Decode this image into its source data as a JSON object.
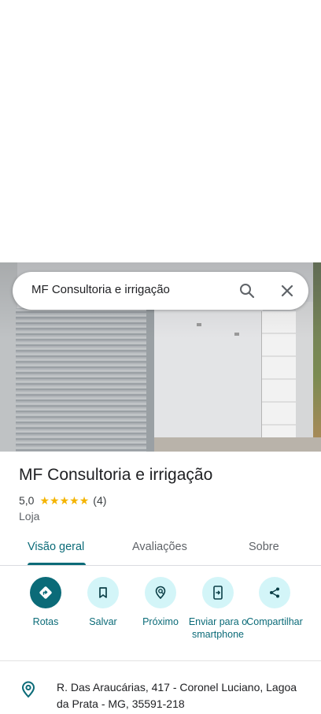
{
  "search": {
    "query": "MF Consultoria e irrigação"
  },
  "place": {
    "title": "MF Consultoria e irrigação",
    "rating": "5,0",
    "stars": 5,
    "review_count": "(4)",
    "category": "Loja"
  },
  "tabs": [
    {
      "label": "Visão geral",
      "active": true
    },
    {
      "label": "Avaliações",
      "active": false
    },
    {
      "label": "Sobre",
      "active": false
    }
  ],
  "actions": [
    {
      "label": "Rotas",
      "icon": "directions-icon"
    },
    {
      "label": "Salvar",
      "icon": "bookmark-icon"
    },
    {
      "label": "Próximo",
      "icon": "nearby-icon"
    },
    {
      "label": "Enviar para o smartphone",
      "icon": "send-to-phone-icon"
    },
    {
      "label": "Compartilhar",
      "icon": "share-icon"
    }
  ],
  "address": {
    "text": "R. Das Araucárias, 417 - Coronel Luciano, Lagoa da Prata - MG, 35591-218"
  },
  "colors": {
    "accent": "#0b6b78",
    "accent_light": "#d3f5f8",
    "star": "#f4b400"
  }
}
